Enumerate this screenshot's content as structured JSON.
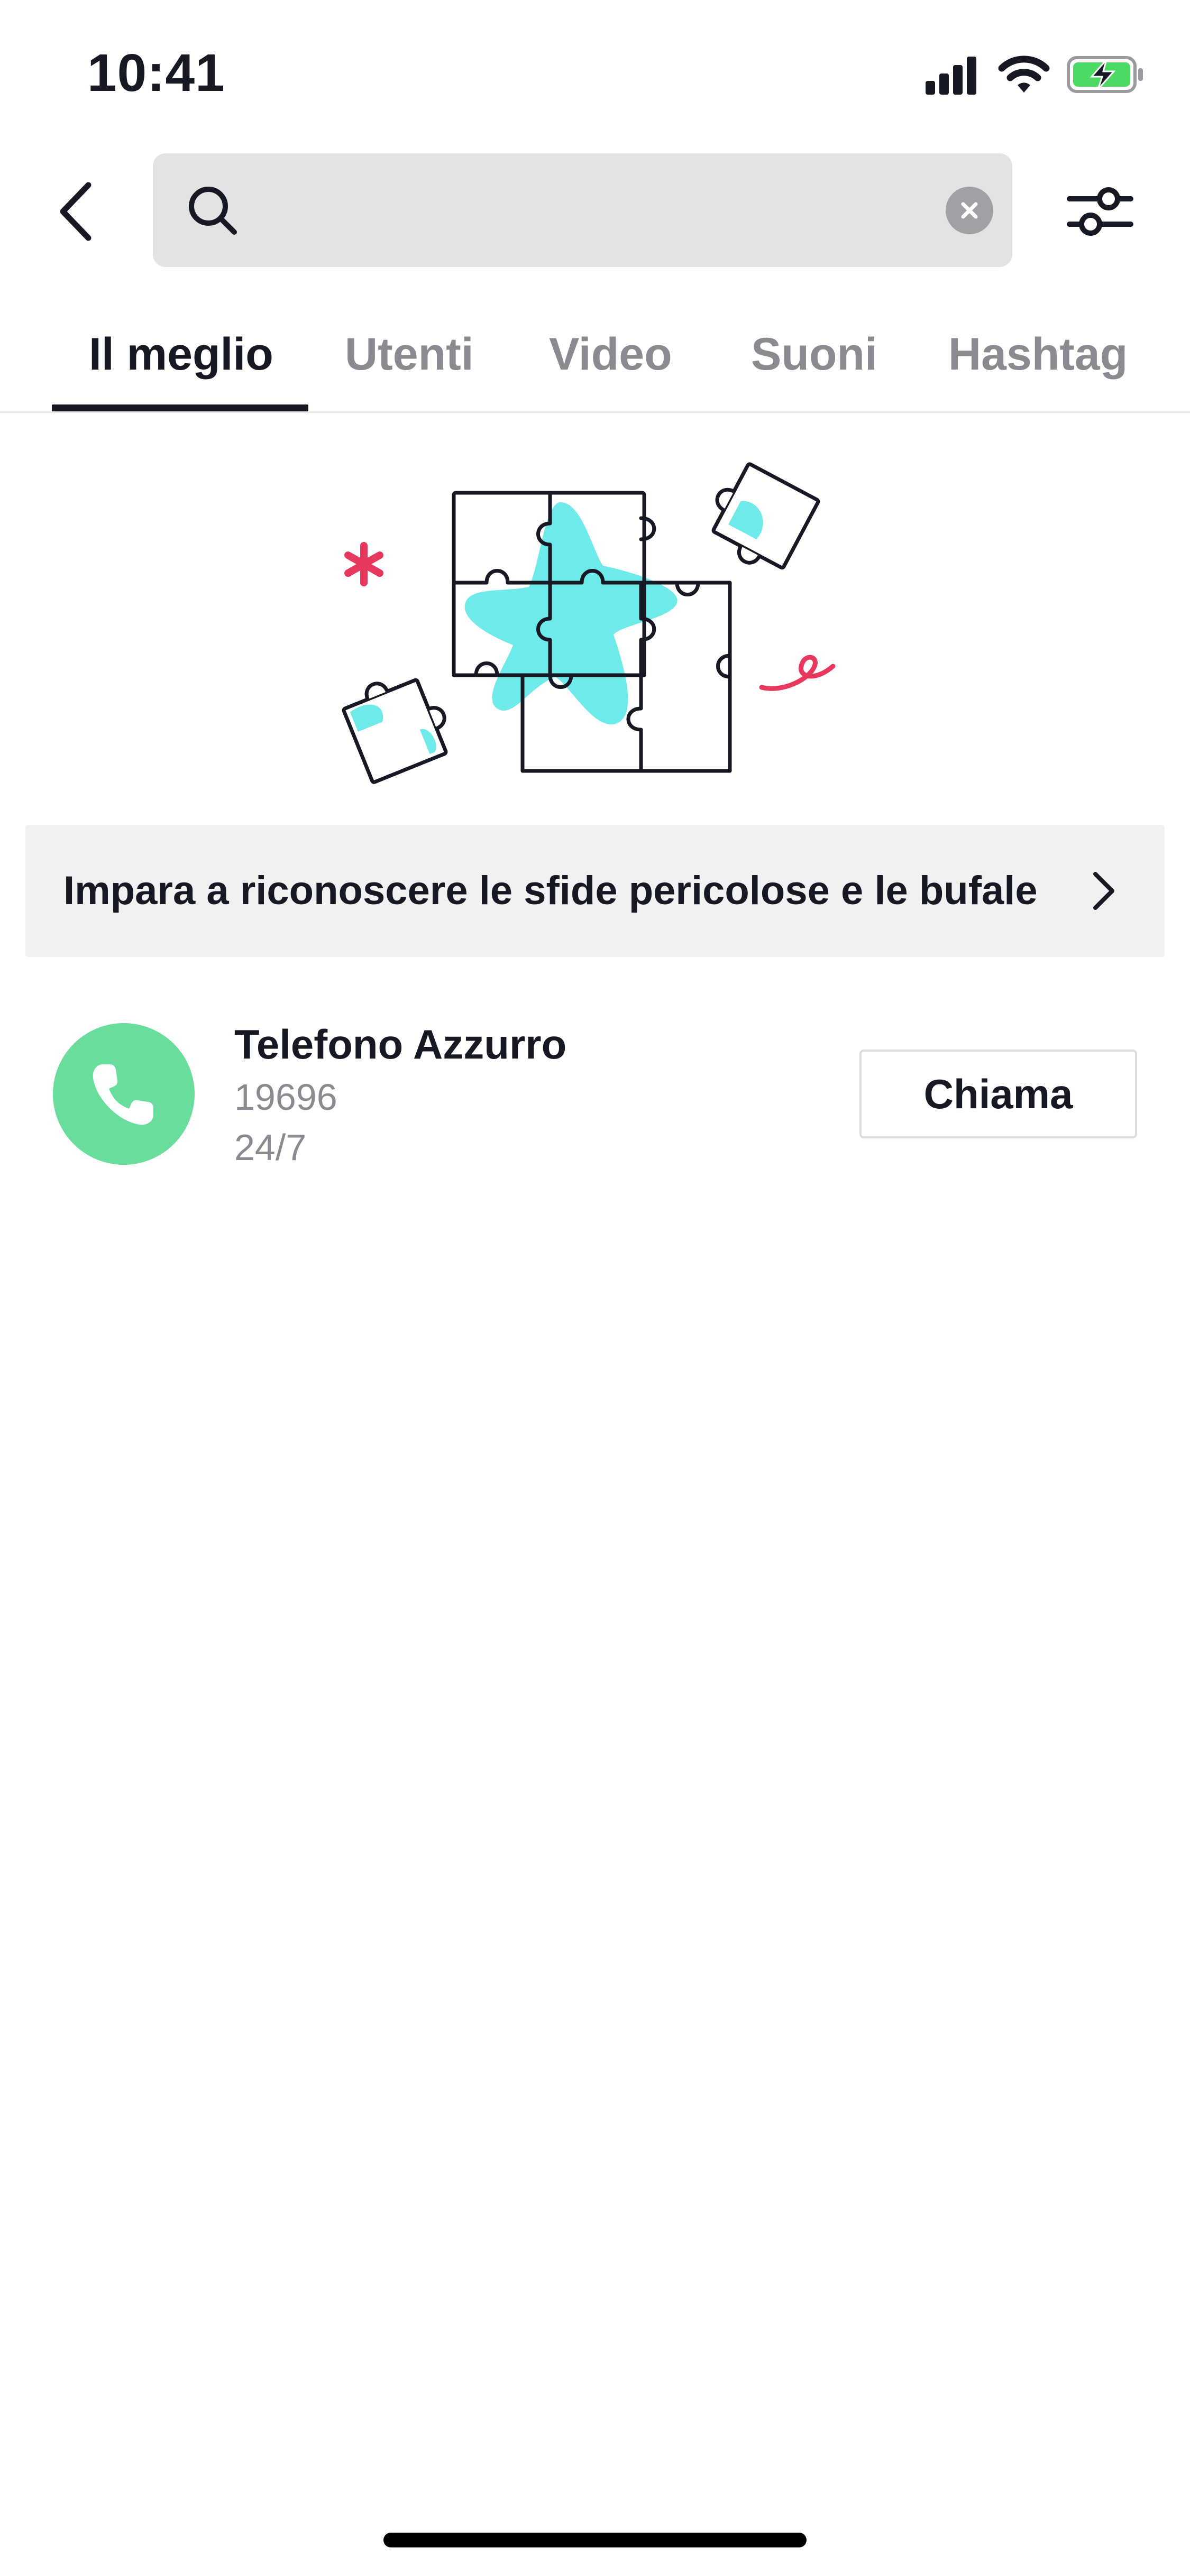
{
  "status_bar": {
    "time": "10:41",
    "icons": [
      "cellular-signal-icon",
      "wifi-icon",
      "battery-charging-icon"
    ]
  },
  "search": {
    "value": "",
    "placeholder": "",
    "icons": [
      "back-arrow-icon",
      "search-icon",
      "clear-icon",
      "filter-sliders-icon"
    ]
  },
  "tabs": [
    {
      "label": "Il meglio",
      "active": true
    },
    {
      "label": "Utenti",
      "active": false
    },
    {
      "label": "Video",
      "active": false
    },
    {
      "label": "Suoni",
      "active": false
    },
    {
      "label": "Hashtag",
      "active": false
    }
  ],
  "banner": {
    "text": "Impara a riconoscere le sfide pericolose e le bufale"
  },
  "helpline": {
    "name": "Telefono Azzurro",
    "number": "19696",
    "hours": "24/7",
    "call_label": "Chiama"
  },
  "colors": {
    "text_primary": "#161823",
    "text_secondary": "#8a8b91",
    "search_bg": "#e3e3e4",
    "banner_bg": "#f1f1f2",
    "phone_green": "#69dd9c",
    "puzzle_cyan": "#6eeaea",
    "accent_pink": "#e8385e",
    "battery_green": "#4cd964"
  }
}
